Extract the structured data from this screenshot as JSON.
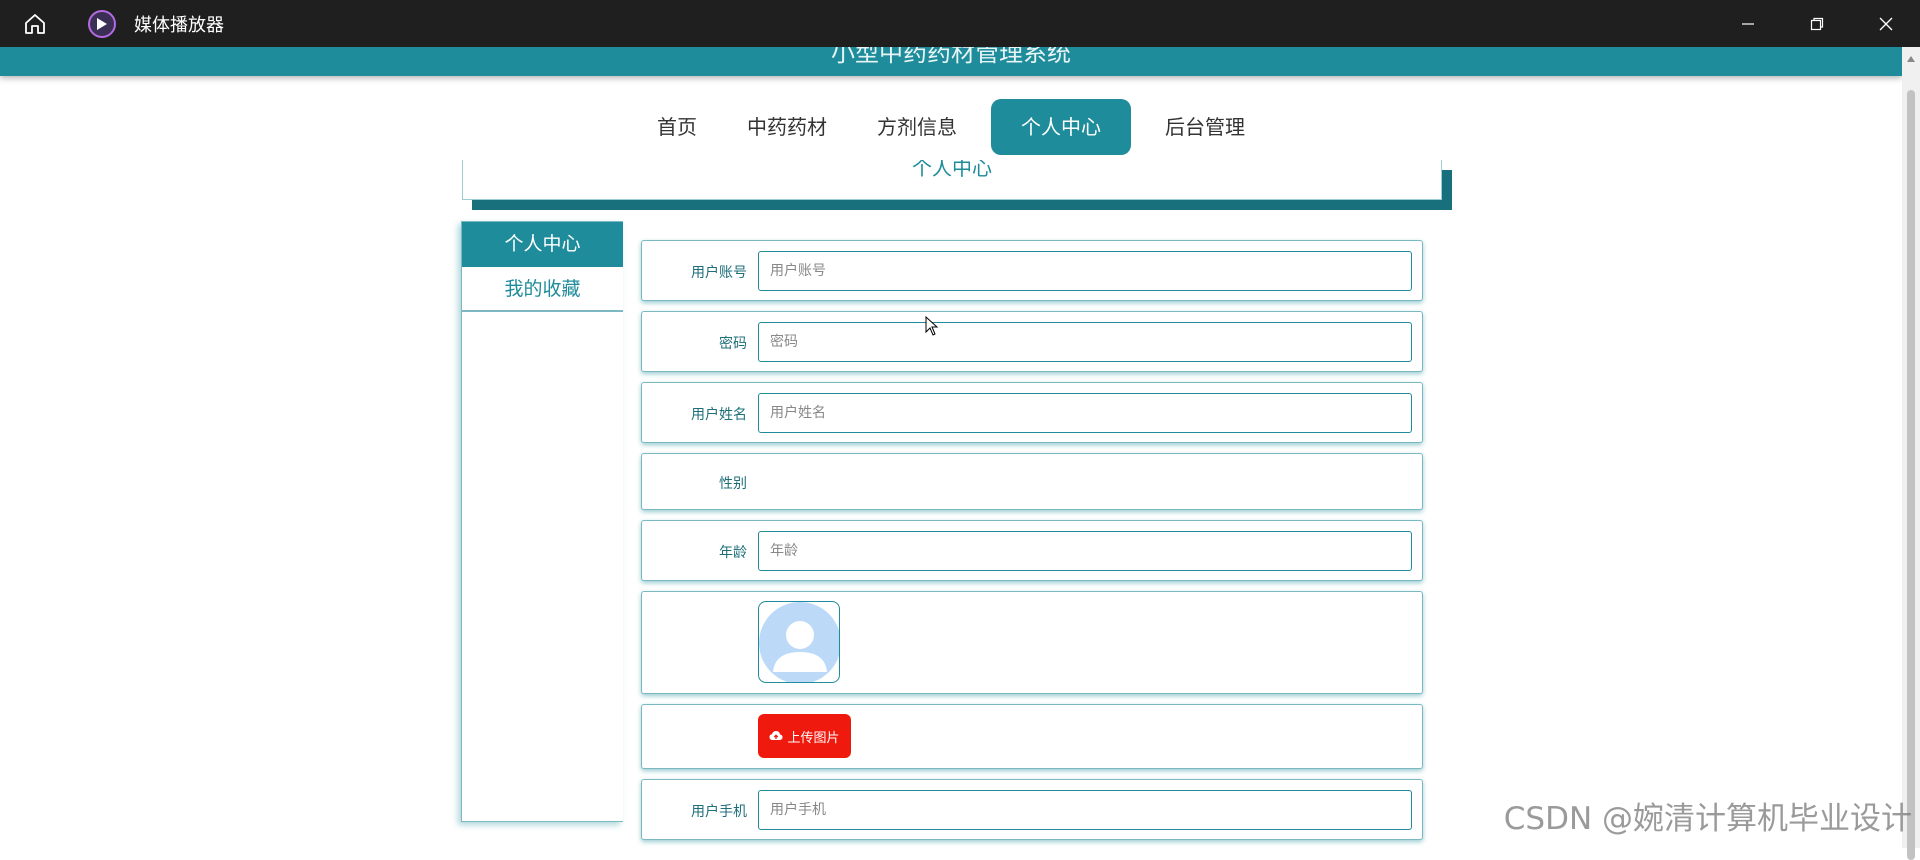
{
  "window": {
    "title": "媒体播放器",
    "icons": [
      "home-icon",
      "media-player-icon",
      "minimize-icon",
      "restore-icon",
      "close-icon"
    ]
  },
  "app": {
    "title": "小型中药药材管理系统"
  },
  "nav": {
    "items": [
      "首页",
      "中药药材",
      "方剂信息",
      "个人中心",
      "后台管理"
    ],
    "active": "个人中心"
  },
  "breadcrumb": {
    "title": "个人中心"
  },
  "side_menu": {
    "items": [
      "个人中心",
      "我的收藏"
    ],
    "active": "个人中心"
  },
  "form": {
    "account": {
      "label": "用户账号",
      "placeholder": "用户账号",
      "value": ""
    },
    "password": {
      "label": "密码",
      "placeholder": "密码",
      "value": ""
    },
    "name": {
      "label": "用户姓名",
      "placeholder": "用户姓名",
      "value": ""
    },
    "gender": {
      "label": "性别"
    },
    "age": {
      "label": "年龄",
      "placeholder": "年龄",
      "value": ""
    },
    "avatar": {
      "icon": "default-avatar-icon"
    },
    "upload": {
      "label": "上传图片",
      "icon": "cloud-upload-icon"
    },
    "phone": {
      "label": "用户手机",
      "placeholder": "用户手机",
      "value": ""
    }
  },
  "watermark": "CSDN @婉清计算机毕业设计",
  "colors": {
    "primary": "#1e8c9a",
    "upload": "#f0190e",
    "titlebar": "#1f1f1f"
  }
}
